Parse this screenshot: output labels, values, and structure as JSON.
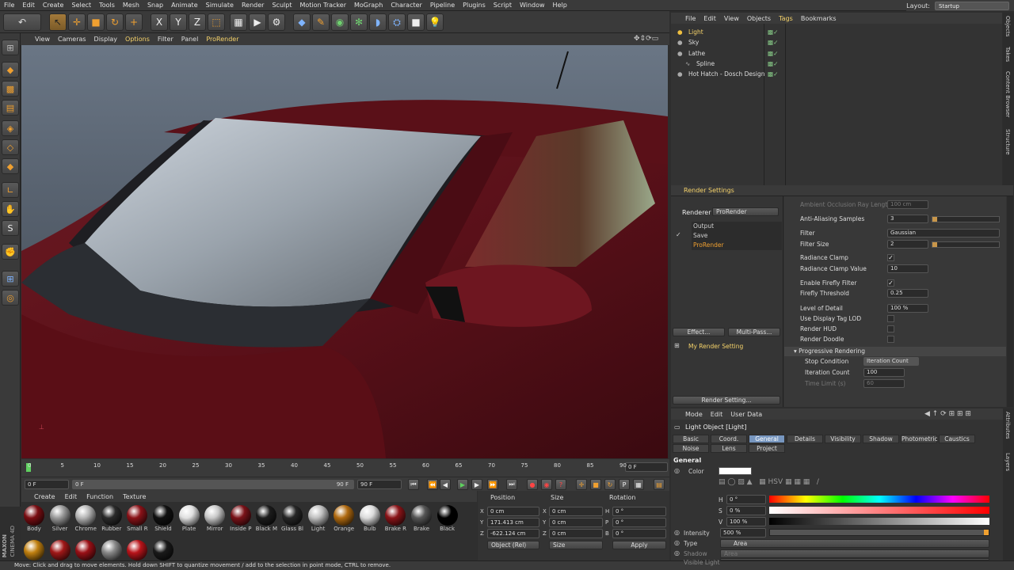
{
  "menubar": {
    "items": [
      "File",
      "Edit",
      "Create",
      "Select",
      "Tools",
      "Mesh",
      "Snap",
      "Animate",
      "Simulate",
      "Render",
      "Sculpt",
      "Motion Tracker",
      "MoGraph",
      "Character",
      "Pipeline",
      "Plugins",
      "Script",
      "Window",
      "Help"
    ],
    "layout_label": "Layout:",
    "layout_value": "Startup"
  },
  "toolbar": {
    "icons": [
      "undo-icon",
      "move-cursor-icon",
      "move-icon",
      "scale-icon",
      "rotate-icon",
      "add-icon",
      "x-axis-icon",
      "y-axis-icon",
      "z-axis-icon",
      "coordinate-system-icon",
      "render-region-icon",
      "render-view-icon",
      "render-settings-icon",
      "cube-icon",
      "pen-icon",
      "subdivision-icon",
      "array-icon",
      "deformer-icon",
      "scene-icon",
      "camera-icon",
      "light-icon"
    ],
    "axis": [
      "X",
      "Y",
      "Z"
    ]
  },
  "viewport": {
    "menu": [
      "View",
      "Cameras",
      "Display",
      "Options",
      "Filter",
      "Panel",
      "ProRender"
    ]
  },
  "timeline": {
    "ticks": [
      "0",
      "5",
      "10",
      "15",
      "20",
      "25",
      "30",
      "35",
      "40",
      "45",
      "50",
      "55",
      "60",
      "65",
      "70",
      "75",
      "80",
      "85",
      "90"
    ],
    "end_field": "0 F",
    "start": "0 F",
    "min": "0 F",
    "max": "90 F",
    "end": "90 F"
  },
  "materials": {
    "menu": [
      "Create",
      "Edit",
      "Function",
      "Texture"
    ],
    "row1": [
      {
        "name": "Body",
        "color": "#7a0d12"
      },
      {
        "name": "Silver",
        "color": "#9a9a9a"
      },
      {
        "name": "Chrome",
        "color": "#b5b5b5"
      },
      {
        "name": "Rubber",
        "color": "#2a2a2a"
      },
      {
        "name": "Small R",
        "color": "#8a1218"
      },
      {
        "name": "Shield",
        "color": "#111"
      },
      {
        "name": "Plate",
        "color": "#e0e0e0"
      },
      {
        "name": "Mirror",
        "color": "#c8c8c8"
      },
      {
        "name": "Inside P",
        "color": "#7a1218"
      },
      {
        "name": "Black M",
        "color": "#1c1c1c"
      },
      {
        "name": "Glass Bl",
        "color": "#262626"
      },
      {
        "name": "Light",
        "color": "#c0c0c0"
      },
      {
        "name": "Orange",
        "color": "#b06a10"
      },
      {
        "name": "Bulb",
        "color": "#dcdcdc"
      },
      {
        "name": "Brake R",
        "color": "#8a1418"
      },
      {
        "name": "Brake",
        "color": "#555"
      },
      {
        "name": "Black",
        "color": "#000"
      }
    ],
    "row2": [
      {
        "color": "#c08010"
      },
      {
        "color": "#a01818"
      },
      {
        "color": "#9a1016"
      },
      {
        "color": "#888"
      },
      {
        "color": "#b8141a"
      },
      {
        "color": "#1a1a1a"
      }
    ]
  },
  "coords": {
    "headers": [
      "Position",
      "Size",
      "Rotation"
    ],
    "pos": {
      "x": "0 cm",
      "y": "171.413 cm",
      "z": "-622.124 cm"
    },
    "size": {
      "x": "0 cm",
      "y": "0 cm",
      "z": "0 cm"
    },
    "rot": {
      "h": "0 °",
      "p": "0 °",
      "b": "0 °"
    },
    "labels": {
      "x": "X",
      "y": "Y",
      "z": "Z",
      "h": "H",
      "p": "P",
      "b": "B"
    },
    "mode": "Object (Rel)",
    "size_mode": "Size",
    "apply": "Apply"
  },
  "status": "Move: Click and drag to move elements. Hold down SHIFT to quantize movement / add to the selection in point mode, CTRL to remove.",
  "brand": {
    "line1": "MAXON",
    "line2": "CINEMA 4D"
  },
  "objects": {
    "menu": [
      "File",
      "Edit",
      "View",
      "Objects",
      "Tags",
      "Bookmarks"
    ],
    "rows": [
      {
        "name": "Light",
        "selected": true,
        "indent": 0
      },
      {
        "name": "Sky",
        "selected": false,
        "indent": 0
      },
      {
        "name": "Lathe",
        "selected": false,
        "indent": 0
      },
      {
        "name": "Spline",
        "selected": false,
        "indent": 1
      },
      {
        "name": "Hot Hatch - Dosch Design",
        "selected": false,
        "indent": 0
      }
    ]
  },
  "sidetabs": {
    "top": [
      "Objects",
      "Takes",
      "Content Browser",
      "Structure"
    ],
    "bottom": [
      "Attributes",
      "Layers"
    ]
  },
  "render_settings": {
    "title": "Render Settings",
    "renderer_label": "Renderer",
    "renderer_value": "ProRender",
    "tree": [
      "Output",
      "Save",
      "ProRender"
    ],
    "effect_btn": "Effect...",
    "multipass_btn": "Multi-Pass...",
    "my_setting": "My Render Setting",
    "render_setting_btn": "Render Setting...",
    "params": [
      {
        "label": "Ambient Occlusion Ray Length",
        "value": "100 cm",
        "kind": "dim"
      },
      {
        "label": "Anti-Aliasing Samples",
        "value": "3",
        "kind": "slider"
      },
      {
        "label": "Filter",
        "value": "Gaussian",
        "kind": "dropdown"
      },
      {
        "label": "Filter Size",
        "value": "2",
        "kind": "slider"
      },
      {
        "label": "Radiance Clamp",
        "value": "✓",
        "kind": "check"
      },
      {
        "label": "Radiance Clamp Value",
        "value": "10",
        "kind": "field"
      },
      {
        "label": "Enable Firefly Filter",
        "value": "✓",
        "kind": "check"
      },
      {
        "label": "Firefly Threshold",
        "value": "0.25",
        "kind": "field"
      },
      {
        "label": "Level of Detail",
        "value": "100 %",
        "kind": "field"
      },
      {
        "label": "Use Display Tag LOD",
        "value": "",
        "kind": "check"
      },
      {
        "label": "Render HUD",
        "value": "",
        "kind": "check"
      },
      {
        "label": "Render Doodle",
        "value": "",
        "kind": "check"
      }
    ],
    "progressive": "Progressive Rendering",
    "stop_label": "Stop Condition",
    "stop_value": "Iteration Count",
    "iter_label": "Iteration Count",
    "iter_value": "100",
    "time_label": "Time Limit (s)",
    "time_value": "60"
  },
  "attributes": {
    "menu": [
      "Mode",
      "Edit",
      "User Data"
    ],
    "object": "Light Object [Light]",
    "tabs1": [
      "Basic",
      "Coord.",
      "General",
      "Details",
      "Visibility",
      "Shadow",
      "Photometric",
      "Caustics"
    ],
    "tabs2": [
      "Noise",
      "Lens",
      "Project"
    ],
    "section": "General",
    "color_label": "Color",
    "h_label": "H",
    "h_value": "0 °",
    "s_label": "S",
    "s_value": "0 %",
    "v_label": "V",
    "v_value": "100 %",
    "intensity_label": "Intensity",
    "intensity_value": "500 %",
    "type_label": "Type",
    "type_value": "Area",
    "shadow_label": "Shadow",
    "shadow_value": "Area",
    "visible_label": "Visible Light",
    "visible_value": "None"
  }
}
